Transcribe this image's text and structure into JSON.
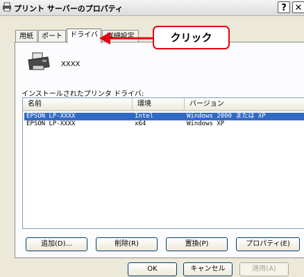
{
  "titlebar": {
    "title": "プリント サーバーのプロパティ",
    "help": "?",
    "close": "✕"
  },
  "tabs": [
    {
      "label": "用紙"
    },
    {
      "label": "ポート"
    },
    {
      "label": "ドライバ"
    },
    {
      "label": "詳細設定"
    }
  ],
  "callout": {
    "text": "クリック"
  },
  "server": {
    "name": "XXXX",
    "icon": "printer-icon"
  },
  "drivers": {
    "label": "インストールされたプリンタ ドライバ:",
    "columns": [
      "名前",
      "環境",
      "バージョン"
    ],
    "rows": [
      {
        "name": "EPSON LP-XXXX",
        "env": "Intel",
        "version": "Windows 2000 または XP",
        "selected": true
      },
      {
        "name": "EPSON LP-XXXX",
        "env": "x64",
        "version": "Windows XP",
        "selected": false
      }
    ]
  },
  "actions": {
    "add": "追加(D)...",
    "remove": "削除(R)",
    "replace": "置換(P)",
    "properties": "プロパティ(E)"
  },
  "footer": {
    "ok": "OK",
    "cancel": "キャンセル",
    "apply": "適用(A)"
  },
  "colors": {
    "accent_red": "#e8000b",
    "selection": "#316ac5"
  }
}
